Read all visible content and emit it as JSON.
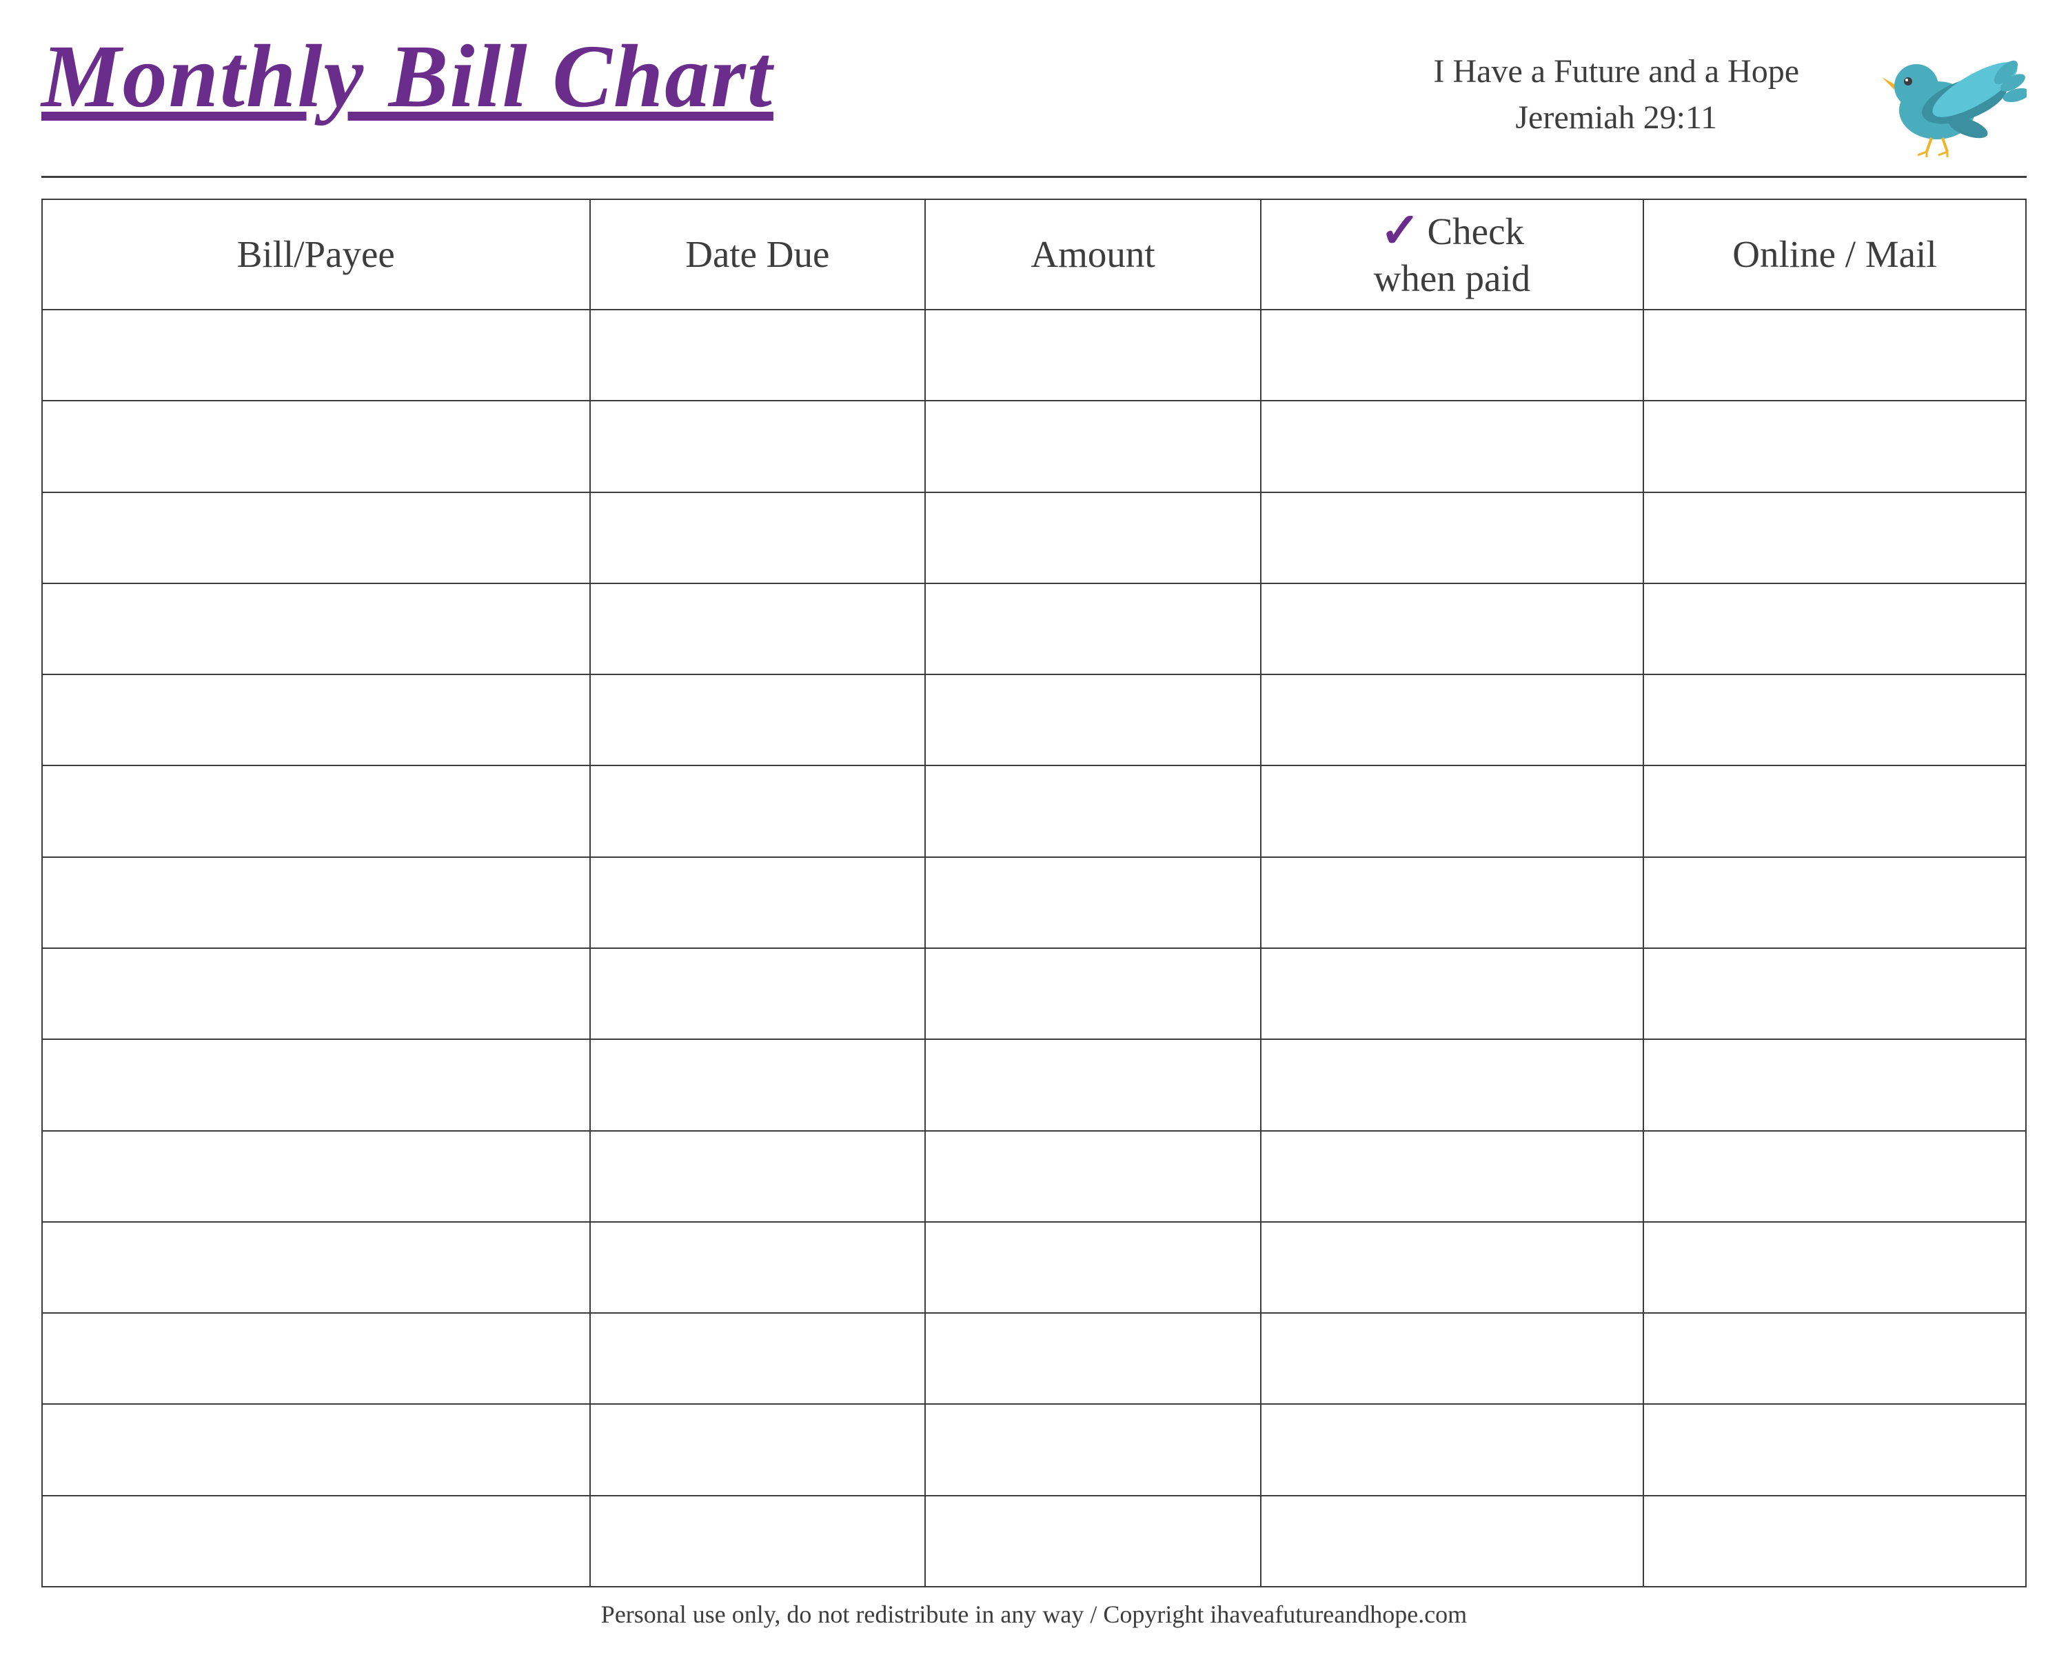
{
  "header": {
    "title": "Monthly Bill Chart",
    "scripture_line1": "I Have a Future and a Hope",
    "scripture_line2": "Jeremiah 29:11"
  },
  "table": {
    "columns": [
      {
        "id": "bill",
        "label": "Bill/Payee"
      },
      {
        "id": "date",
        "label": "Date Due"
      },
      {
        "id": "amount",
        "label": "Amount"
      },
      {
        "id": "check",
        "label_top": "Check",
        "label_bottom": "when paid"
      },
      {
        "id": "online",
        "label": "Online / Mail"
      }
    ],
    "row_count": 14
  },
  "footer": {
    "text": "Personal use only, do not redistribute in any way / Copyright ihaveafutureandhope.com"
  },
  "colors": {
    "title": "#6b2d8b",
    "text": "#3d3d3d",
    "checkmark": "#6b2d8b",
    "bird_body": "#4aadbe",
    "bird_wing": "#3a8fa0",
    "bird_beak": "#f0b429",
    "bird_eye": "#3d3d3d"
  }
}
